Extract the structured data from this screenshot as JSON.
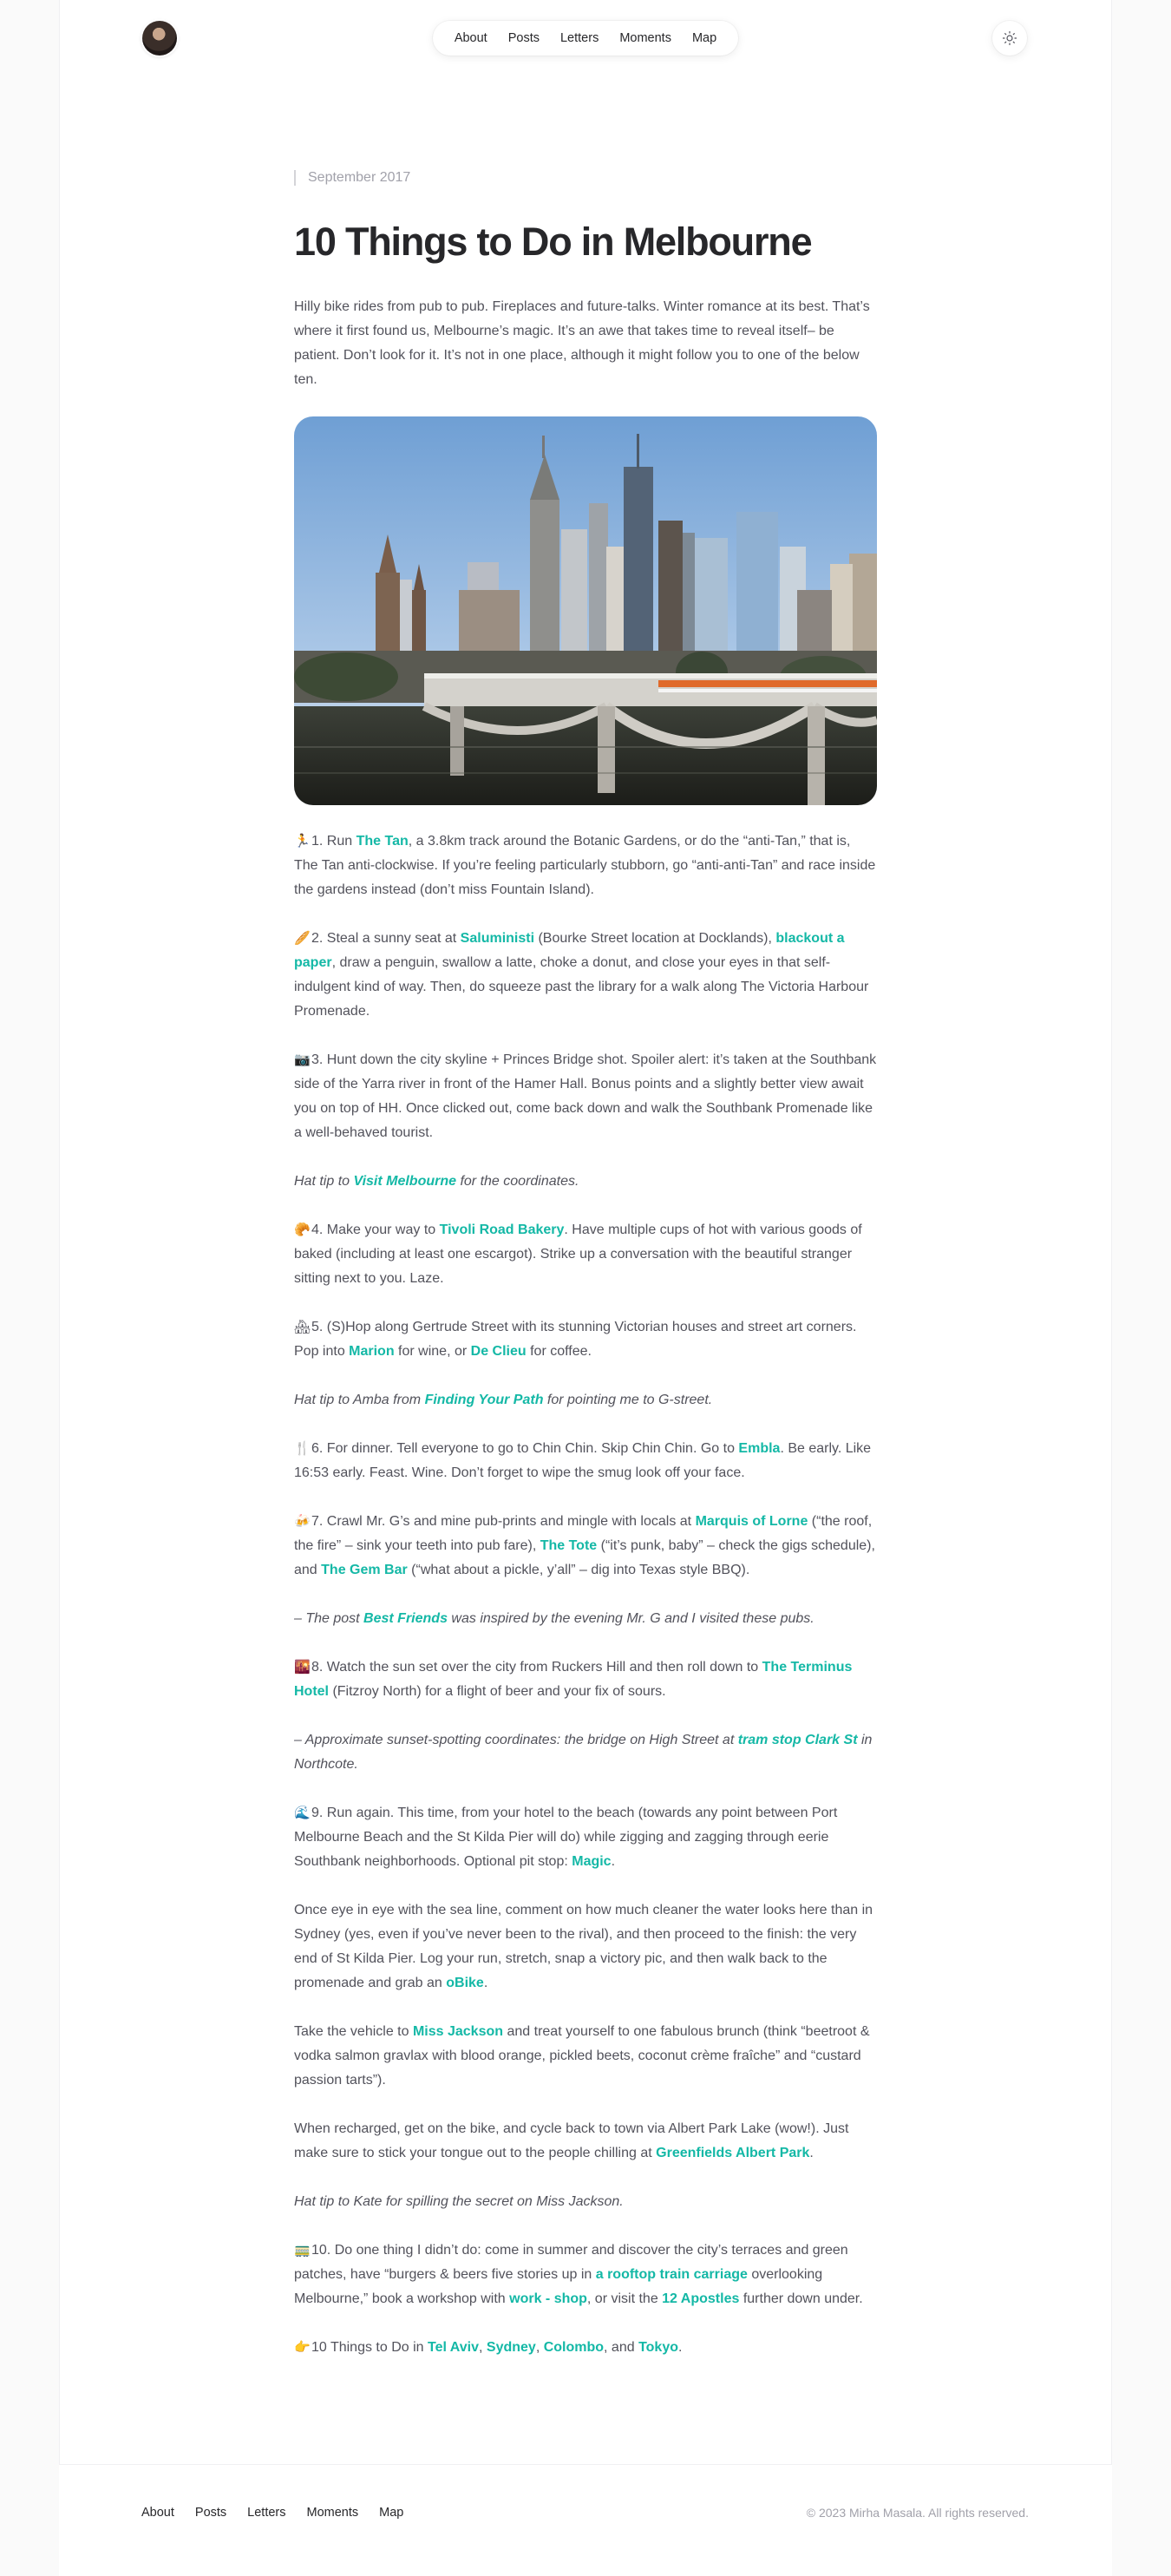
{
  "header": {
    "nav": [
      "About",
      "Posts",
      "Letters",
      "Moments",
      "Map"
    ]
  },
  "article": {
    "date": "September 2017",
    "title": "10 Things to Do in Melbourne",
    "intro": "Hilly bike rides from pub to pub. Fireplaces and future-talks. Winter romance at its best. That’s where it first found us, Melbourne’s magic. It’s an awe that takes time to reveal itself– be patient. Don’t look for it. It’s not in one place, although it might follow you to one of the below ten.",
    "hero_image_icon": "melbourne-skyline-image"
  },
  "items": [
    {
      "icon": "🏃",
      "segments": [
        {
          "t": "1. Run "
        },
        {
          "t": "The Tan",
          "link": true
        },
        {
          "t": ", a 3.8km track around the Botanic Gardens, or do the “anti-Tan,” that is, The Tan anti-clockwise. If you’re feeling particularly stubborn, go “anti-anti-Tan” and race inside the gardens instead (don’t miss Fountain Island)."
        }
      ]
    },
    {
      "icon": "🥖",
      "segments": [
        {
          "t": "2. Steal a sunny seat at "
        },
        {
          "t": "Saluministi",
          "link": true
        },
        {
          "t": " (Bourke Street location at Docklands), "
        },
        {
          "t": "blackout a paper",
          "link": true
        },
        {
          "t": ", draw a penguin, swallow a latte, choke a donut, and close your eyes in that self-indulgent kind of way. Then, do squeeze past the library for a walk along The Victoria Harbour Promenade."
        }
      ]
    },
    {
      "icon": "📷",
      "segments": [
        {
          "t": "3. Hunt down the city skyline + Princes Bridge shot. Spoiler alert: it’s taken at the Southbank side of the Yarra river in front of the Hamer Hall. Bonus points and a slightly better view await you on top of HH. Once clicked out, come back down and walk the Southbank Promenade like a well-behaved tourist."
        }
      ]
    },
    {
      "tip": true,
      "segments": [
        {
          "t": "Hat tip to "
        },
        {
          "t": "Visit Melbourne",
          "link": true
        },
        {
          "t": " for the coordinates."
        }
      ]
    },
    {
      "icon": "🥐",
      "segments": [
        {
          "t": "4. Make your way to "
        },
        {
          "t": "Tivoli Road Bakery",
          "link": true
        },
        {
          "t": ". Have multiple cups of hot with various goods of baked (including at least one escargot). Strike up a conversation with the beautiful stranger sitting next to you. Laze."
        }
      ]
    },
    {
      "icon": "🏘",
      "segments": [
        {
          "t": "5. (S)Hop along Gertrude Street with its stunning Victorian houses and street art corners. Pop into "
        },
        {
          "t": "Marion",
          "link": true
        },
        {
          "t": " for wine, or "
        },
        {
          "t": "De Clieu",
          "link": true
        },
        {
          "t": " for coffee."
        }
      ]
    },
    {
      "tip": true,
      "segments": [
        {
          "t": "Hat tip to Amba from "
        },
        {
          "t": "Finding Your Path",
          "link": true
        },
        {
          "t": " for pointing me to G-street."
        }
      ]
    },
    {
      "icon": "🍴",
      "segments": [
        {
          "t": "6. For dinner. Tell everyone to go to Chin Chin. Skip Chin Chin. Go to "
        },
        {
          "t": "Embla",
          "link": true
        },
        {
          "t": ". Be early. Like 16:53 early. Feast. Wine. Don’t forget to wipe the smug look off your face."
        }
      ]
    },
    {
      "icon": "🍻",
      "segments": [
        {
          "t": "7. Crawl Mr. G’s and mine pub-prints and mingle with locals at "
        },
        {
          "t": "Marquis of Lorne",
          "link": true
        },
        {
          "t": " (“the roof, the fire” – sink your teeth into pub fare), "
        },
        {
          "t": "The Tote",
          "link": true
        },
        {
          "t": " (“it’s punk, baby” – check the gigs schedule), and "
        },
        {
          "t": "The Gem Bar",
          "link": true
        },
        {
          "t": " (“what about a pickle, y’all” – dig into Texas style BBQ)."
        }
      ]
    },
    {
      "tip": true,
      "segments": [
        {
          "t": "– The post "
        },
        {
          "t": "Best Friends",
          "link": true
        },
        {
          "t": " was inspired by the evening Mr. G and I visited these pubs."
        }
      ]
    },
    {
      "icon": "🌇",
      "segments": [
        {
          "t": "8. Watch the sun set over the city from Ruckers Hill and then roll down to "
        },
        {
          "t": "The Terminus Hotel",
          "link": true
        },
        {
          "t": " (Fitzroy North) for a flight of beer and your fix of sours."
        }
      ]
    },
    {
      "tip": true,
      "segments": [
        {
          "t": "– Approximate sunset-spotting coordinates: the bridge on High Street at "
        },
        {
          "t": "tram stop Clark St",
          "link": true
        },
        {
          "t": " in Northcote."
        }
      ]
    },
    {
      "icon": "🌊",
      "segments": [
        {
          "t": "9. Run again. This time, from your hotel to the beach (towards any point between Port Melbourne Beach and the St Kilda Pier will do) while zigging and zagging through eerie Southbank neighborhoods. Optional pit stop: "
        },
        {
          "t": "Magic",
          "link": true
        },
        {
          "t": "."
        }
      ]
    },
    {
      "segments": [
        {
          "t": "Once eye in eye with the sea line, comment on how much cleaner the water looks here than in Sydney (yes, even if you’ve never been to the rival), and then proceed to the finish: the very end of St Kilda Pier. Log your run, stretch, snap a victory pic, and then walk back to the promenade and grab an "
        },
        {
          "t": "oBike",
          "link": true
        },
        {
          "t": "."
        }
      ]
    },
    {
      "segments": [
        {
          "t": "Take the vehicle to "
        },
        {
          "t": "Miss Jackson",
          "link": true
        },
        {
          "t": " and treat yourself to one fabulous brunch (think “beetroot & vodka salmon gravlax with blood orange, pickled beets, coconut crème fraîche” and “custard passion tarts”)."
        }
      ]
    },
    {
      "segments": [
        {
          "t": "When recharged, get on the bike, and cycle back to town via Albert Park Lake (wow!). Just make sure to stick your tongue out to the people chilling at "
        },
        {
          "t": "Greenfields Albert Park",
          "link": true
        },
        {
          "t": "."
        }
      ]
    },
    {
      "tip": true,
      "segments": [
        {
          "t": "Hat tip to Kate for spilling the secret on Miss Jackson."
        }
      ]
    },
    {
      "icon": "🚃",
      "segments": [
        {
          "t": "10. Do one thing I didn’t do: come in summer and discover the city’s terraces and green patches, have “burgers & beers five stories up in "
        },
        {
          "t": "a rooftop train carriage",
          "link": true
        },
        {
          "t": " overlooking Melbourne,” book a workshop with "
        },
        {
          "t": "work - shop",
          "link": true
        },
        {
          "t": ", or visit the "
        },
        {
          "t": "12 Apostles",
          "link": true
        },
        {
          "t": " further down under."
        }
      ]
    },
    {
      "icon": "👉",
      "segments": [
        {
          "t": "10 Things to Do in "
        },
        {
          "t": "Tel Aviv",
          "link": true
        },
        {
          "t": ", "
        },
        {
          "t": "Sydney",
          "link": true
        },
        {
          "t": ", "
        },
        {
          "t": "Colombo",
          "link": true
        },
        {
          "t": ", and "
        },
        {
          "t": "Tokyo",
          "link": true
        },
        {
          "t": "."
        }
      ]
    }
  ],
  "footer": {
    "nav": [
      "About",
      "Posts",
      "Letters",
      "Moments",
      "Map"
    ],
    "copyright": "© 2023 Mirha Masala. All rights reserved."
  },
  "colors": {
    "accent": "#14b8a6",
    "text": "#52525b",
    "heading": "#27272a",
    "muted": "#a1a1aa"
  }
}
